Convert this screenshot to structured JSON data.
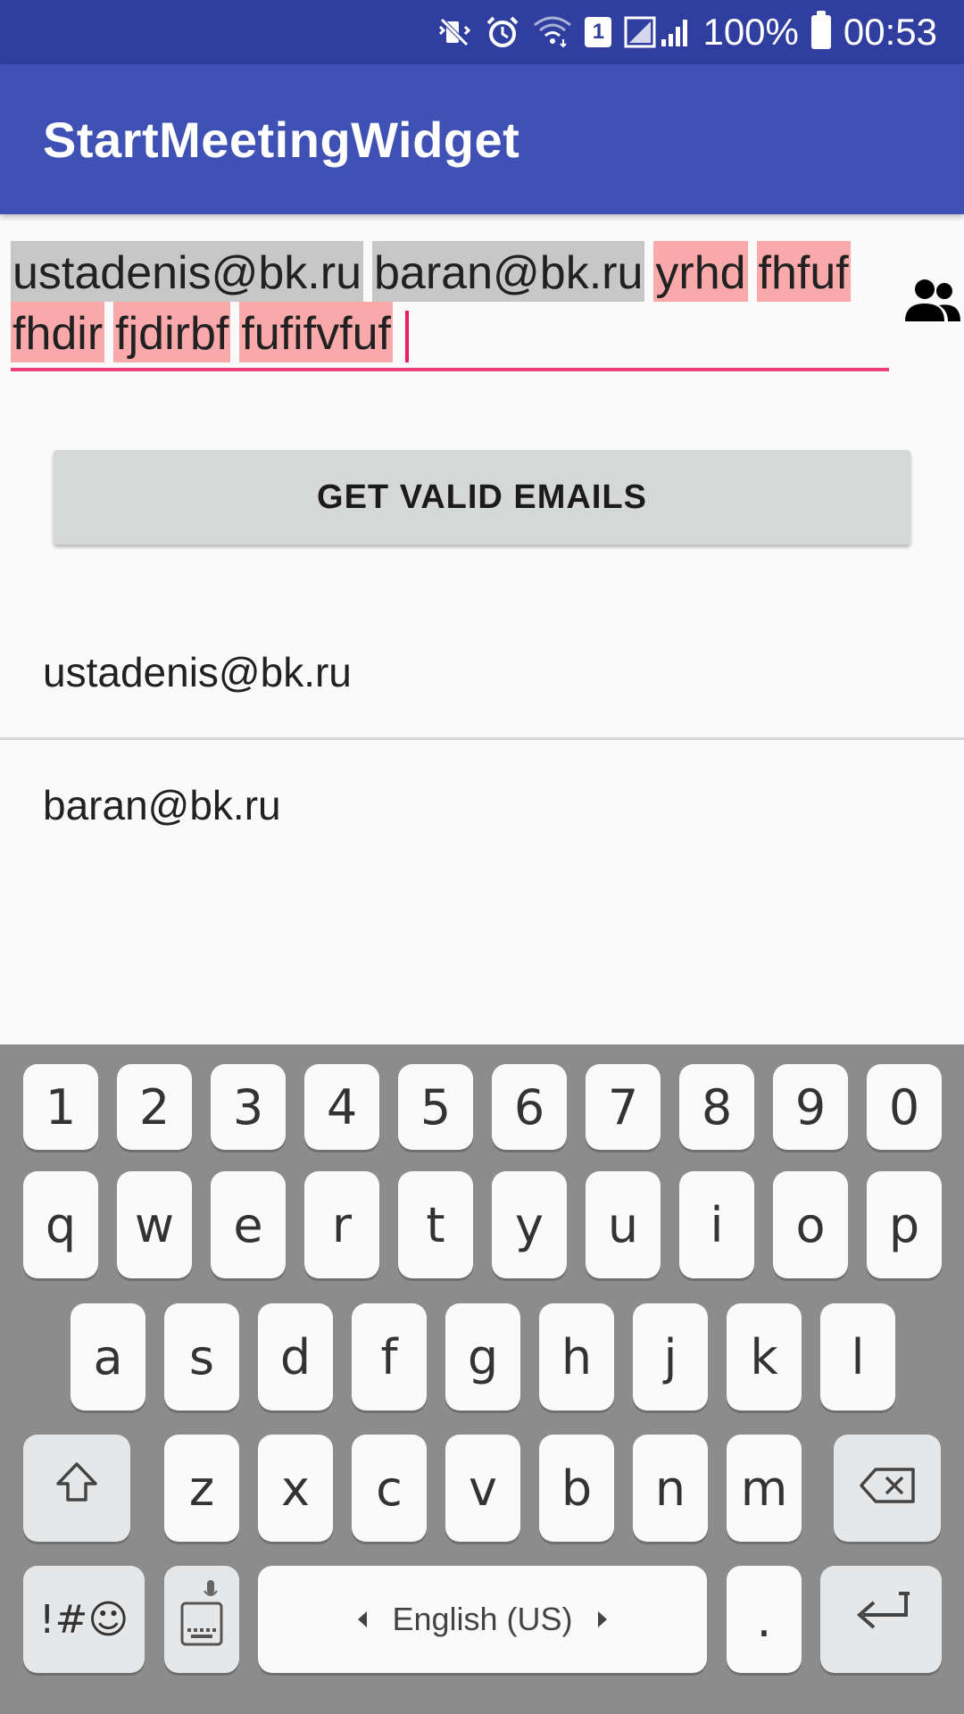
{
  "status_bar": {
    "battery_text": "100%",
    "time": "00:53",
    "sim_slot": "1",
    "icons": [
      "mute-vibrate-icon",
      "alarm-icon",
      "wifi-icon",
      "sim-icon",
      "signal-icon",
      "battery-icon"
    ]
  },
  "app_bar": {
    "title": "StartMeetingWidget"
  },
  "recipients": {
    "chips": [
      {
        "text": "ustadenis@bk.ru",
        "valid": true
      },
      {
        "text": "baran@bk.ru",
        "valid": true
      },
      {
        "text": "yrhd",
        "valid": false
      },
      {
        "text": "fhfuf",
        "valid": false
      },
      {
        "text": "fhdir",
        "valid": false
      },
      {
        "text": "fjdirbf",
        "valid": false
      },
      {
        "text": "fufifvfuf",
        "valid": false
      }
    ],
    "contacts_icon": "contacts-icon",
    "accent_color": "#EC407A",
    "valid_chip_color": "#C7C7C7",
    "invalid_chip_color": "#F9A9A9"
  },
  "action": {
    "button_label": "GET VALID EMAILS"
  },
  "valid_emails": [
    "ustadenis@bk.ru",
    "baran@bk.ru"
  ],
  "keyboard": {
    "number_row": [
      "1",
      "2",
      "3",
      "4",
      "5",
      "6",
      "7",
      "8",
      "9",
      "0"
    ],
    "row1": [
      "q",
      "w",
      "e",
      "r",
      "t",
      "y",
      "u",
      "i",
      "o",
      "p"
    ],
    "row2": [
      "a",
      "s",
      "d",
      "f",
      "g",
      "h",
      "j",
      "k",
      "l"
    ],
    "row3": [
      "z",
      "x",
      "c",
      "v",
      "b",
      "n",
      "m"
    ],
    "symbols_label": "!#☺",
    "space_label": "English (US)",
    "period_label": ".",
    "icons": [
      "shift-icon",
      "backspace-icon",
      "keyboard-mic-icon",
      "enter-icon"
    ]
  },
  "colors": {
    "status_bar": "#303F9F",
    "app_bar": "#3F51B5",
    "button": "#D6D7D7",
    "keyboard_bg": "#8C8C8C"
  }
}
